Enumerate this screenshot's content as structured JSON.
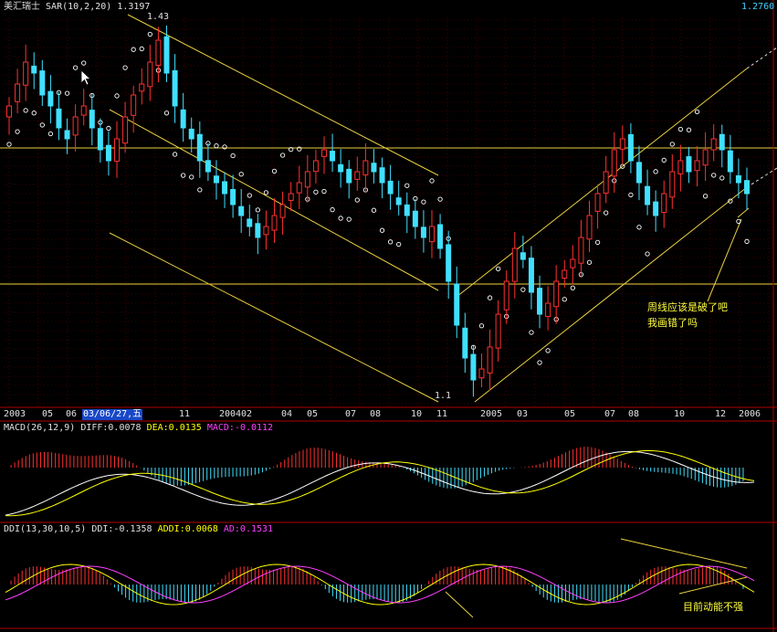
{
  "header": {
    "symbol": "美汇瑞士",
    "indicator": "SAR(10,2,20)",
    "value": "1.3197",
    "right_price": "1.2760"
  },
  "price_labels": {
    "high": "1.43",
    "low": "1.1"
  },
  "x_axis": {
    "ticks": [
      "2003",
      "05",
      "06",
      "03/06/27,五",
      "11",
      "2004",
      "02",
      "04",
      "05",
      "07",
      "08",
      "10",
      "11",
      "2005",
      "03",
      "05",
      "07",
      "08",
      "10",
      "12",
      "2006"
    ],
    "selected": "03/06/27,五"
  },
  "macd": {
    "title": "MACD(26,12,9)",
    "diff_label": "DIFF:0.0078",
    "dea_label": "DEA:0.0135",
    "macd_label": "MACD:-0.0112"
  },
  "ddi": {
    "title": "DDI(13,30,10,5)",
    "ddi_label": "DDI:-0.1358",
    "addi_label": "ADDI:0.0068",
    "ad_label": "AD:0.1531"
  },
  "annotations": {
    "note1_line1": "周线应该是破了吧",
    "note1_line2": "我画错了吗",
    "note2": "目前动能不强"
  },
  "colors": {
    "background": "#000000",
    "up": "#ff3030",
    "down": "#40e0ff",
    "sar": "#ffffff",
    "trendline": "#e8d040",
    "grid": "#7a0000",
    "diff": "#ffffff",
    "dea": "#ffff00",
    "ad": "#ff40ff"
  },
  "chart_data": [
    {
      "type": "candlestick",
      "title": "美汇瑞士 SAR(10,2,20)",
      "x_ticks": [
        "2003",
        "05",
        "06",
        "03/06/27",
        "11",
        "2004",
        "02",
        "04",
        "05",
        "07",
        "08",
        "10",
        "11",
        "2005",
        "03",
        "05",
        "07",
        "08",
        "10",
        "12",
        "2006"
      ],
      "closes": [
        1.36,
        1.38,
        1.4,
        1.39,
        1.37,
        1.36,
        1.34,
        1.33,
        1.35,
        1.36,
        1.34,
        1.32,
        1.31,
        1.33,
        1.35,
        1.37,
        1.38,
        1.4,
        1.42,
        1.39,
        1.36,
        1.34,
        1.33,
        1.31,
        1.3,
        1.29,
        1.28,
        1.27,
        1.26,
        1.25,
        1.24,
        1.25,
        1.26,
        1.27,
        1.28,
        1.29,
        1.3,
        1.31,
        1.32,
        1.31,
        1.3,
        1.29,
        1.3,
        1.31,
        1.3,
        1.29,
        1.28,
        1.27,
        1.26,
        1.25,
        1.24,
        1.25,
        1.23,
        1.2,
        1.16,
        1.13,
        1.11,
        1.12,
        1.14,
        1.17,
        1.2,
        1.23,
        1.22,
        1.19,
        1.17,
        1.18,
        1.2,
        1.21,
        1.22,
        1.24,
        1.26,
        1.28,
        1.3,
        1.32,
        1.33,
        1.31,
        1.29,
        1.27,
        1.26,
        1.28,
        1.3,
        1.31,
        1.3,
        1.31,
        1.32,
        1.33,
        1.32,
        1.3,
        1.29,
        1.28
      ],
      "annotated_high": 1.43,
      "annotated_low": 1.1,
      "last_price": 1.276,
      "horizontal_levels": "two yellow support/resistance lines"
    },
    {
      "type": "line",
      "title": "MACD(26,12,9)",
      "series": [
        {
          "name": "DIFF",
          "last": 0.0078
        },
        {
          "name": "DEA",
          "last": 0.0135
        },
        {
          "name": "MACD",
          "last": -0.0112
        }
      ]
    },
    {
      "type": "line",
      "title": "DDI(13,30,10,5)",
      "series": [
        {
          "name": "DDI",
          "last": -0.1358
        },
        {
          "name": "ADDI",
          "last": 0.0068
        },
        {
          "name": "AD",
          "last": 0.1531
        }
      ]
    }
  ]
}
